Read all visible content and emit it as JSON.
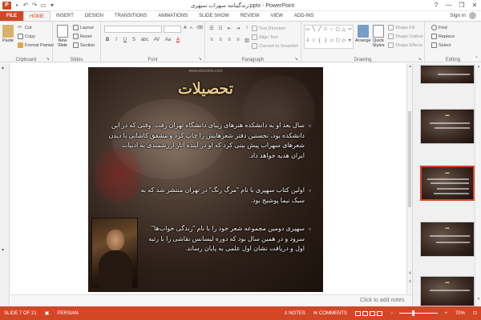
{
  "window": {
    "title": "زندگینامه سهراب سپهری.pptx - PowerPoint",
    "app_icon": "P",
    "signin": "Sign in",
    "controls": [
      "?",
      "—",
      "❐",
      "✕"
    ]
  },
  "tabs": [
    "FILE",
    "HOME",
    "INSERT",
    "DESIGN",
    "TRANSITIONS",
    "ANIMATIONS",
    "SLIDE SHOW",
    "REVIEW",
    "VIEW",
    "ADD-INS"
  ],
  "active_tab": "HOME",
  "ribbon": {
    "clipboard": {
      "label": "Clipboard",
      "paste": "Paste",
      "cut": "Cut",
      "copy": "Copy",
      "format_painter": "Format Painter"
    },
    "slides": {
      "label": "Slides",
      "new_slide": "New Slide",
      "layout": "Layout",
      "reset": "Reset",
      "section": "Section"
    },
    "font": {
      "label": "Font",
      "buttons": [
        "B",
        "I",
        "U",
        "S",
        "abc",
        "AV",
        "Aa",
        "A"
      ]
    },
    "paragraph": {
      "label": "Paragraph",
      "text_direction": "Text Direction",
      "align_text": "Align Text",
      "convert_smartart": "Convert to SmartArt"
    },
    "drawing": {
      "label": "Drawing",
      "arrange": "Arrange",
      "quick_styles": "Quick Styles",
      "shape_fill": "Shape Fill",
      "shape_outline": "Shape Outline",
      "shape_effects": "Shape Effects"
    },
    "editing": {
      "label": "Editing",
      "find": "Find",
      "replace": "Replace",
      "select": "Select"
    }
  },
  "slide": {
    "watermark_url": "www.ebook4u.com",
    "title": "تحصیلات",
    "bullets": [
      "سال بعد او به دانشکده هنرهای زیبای دانشگاه تهران رفت. وقتی که در این دانشکده بود، نخستین دفتر شعرهایش را چاپ کرد و مشفق کاشانی با دیدن شعرهای سهراب پیش بینی کرد که او در آینده آثار ارزشمندی به ادبیات ایران هدیه خواهد داد.",
      "اولین کتاب سهپری با نام \"مرگ رنگ\" در تهران منتشر شد که به سبک نیما پوشیج بود.",
      "سهپری دومین مجموعه شعر خود را با نام \"زندگی خواب‌ها\" سرود و در همین سال بود که دوره لیسانس نقاشی را با رتبه اول و دریافت نشان اول علمی به پایان رساند."
    ],
    "bullet_marker": "▫"
  },
  "notes_placeholder": "Click to add notes",
  "thumbnails": [
    {
      "number": "6",
      "selected": false
    },
    {
      "number": "7",
      "selected": true
    },
    {
      "number": "8",
      "selected": false
    },
    {
      "number": "9",
      "selected": false
    }
  ],
  "status": {
    "slide_indicator": "SLIDE 7 OF 21",
    "language": "PERSIAN",
    "notes": "NOTES",
    "comments": "COMMENTS",
    "zoom": "70%"
  },
  "colors": {
    "accent": "#d24726",
    "title_gold": "#e8c888"
  }
}
